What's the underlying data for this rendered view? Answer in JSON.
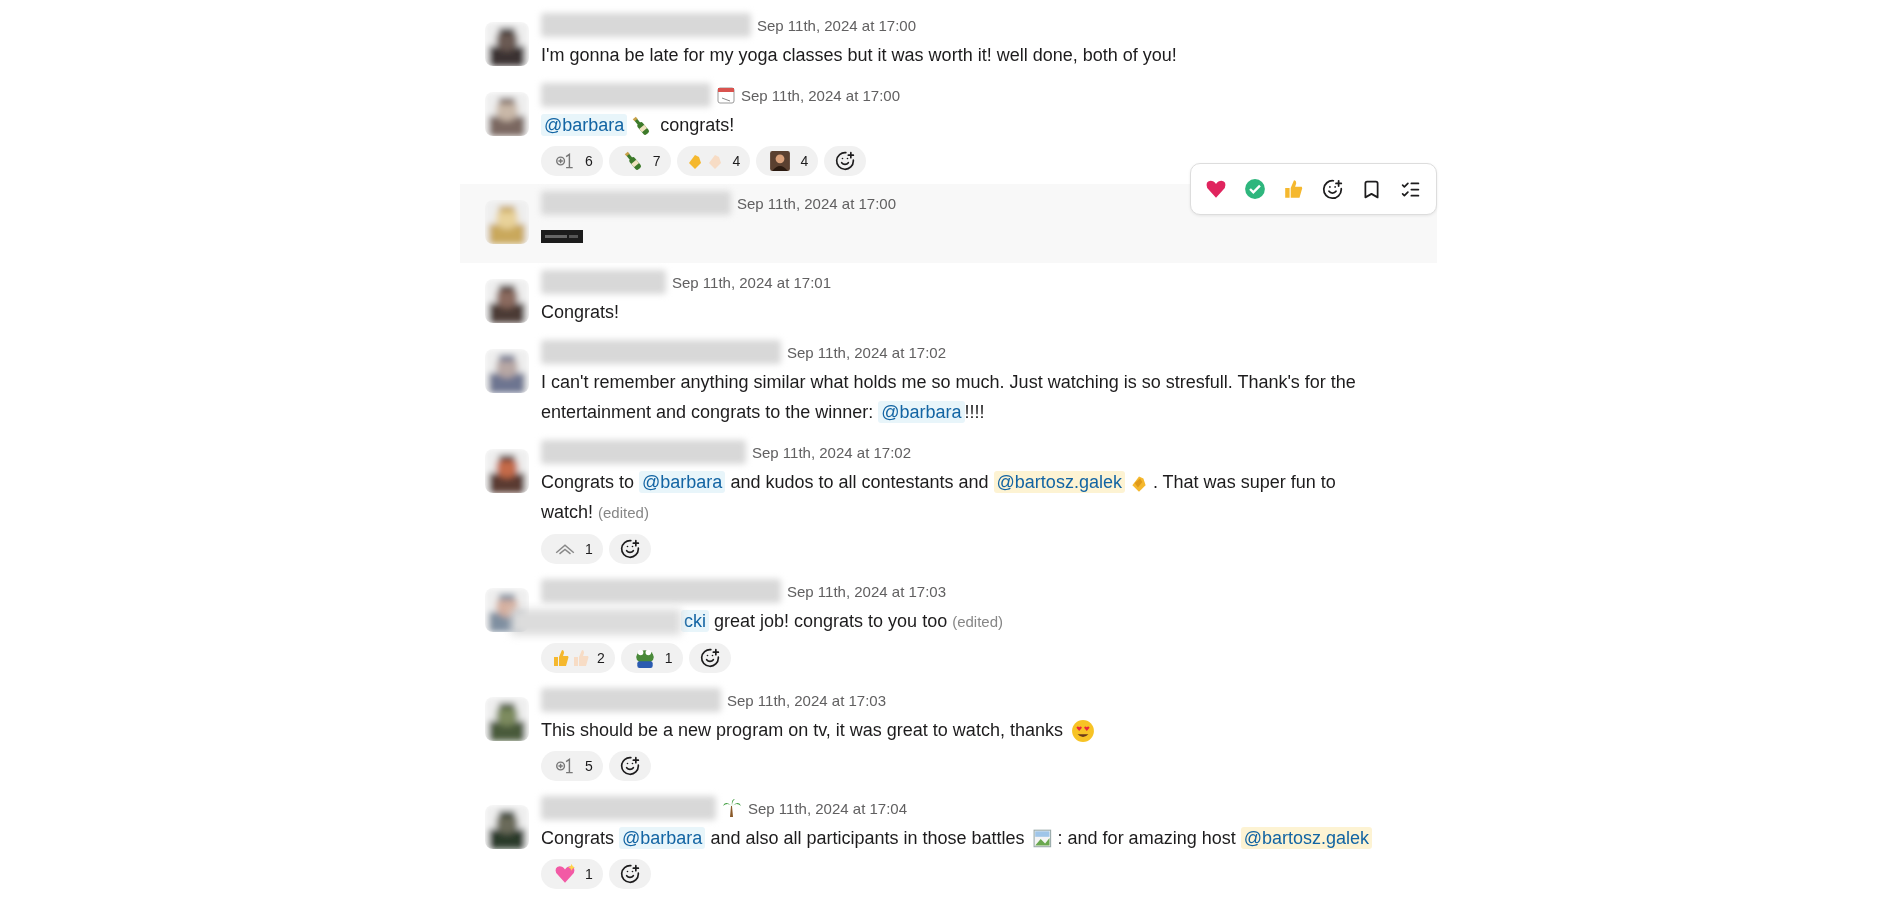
{
  "messages": [
    {
      "time": "Sep 11th, 2024 at 17:00",
      "hovered": false,
      "body": [
        {
          "kind": "text",
          "text": "I'm gonna be late for my yoga classes but it was worth it! well done, both of you!"
        }
      ]
    },
    {
      "time": "Sep 11th, 2024 at 17:00",
      "status": {
        "kind": "calendar"
      },
      "hovered": false,
      "body": [
        {
          "kind": "mention",
          "text": "@barbara",
          "self": false
        },
        {
          "kind": "bottle"
        },
        {
          "kind": "text",
          "text": " congrats!"
        }
      ],
      "reactions": [
        {
          "kind": "plusone",
          "count": "6"
        },
        {
          "kind": "bottle",
          "count": "7"
        },
        {
          "kind": "claps",
          "count": "4"
        },
        {
          "kind": "person",
          "count": "4"
        }
      ]
    },
    {
      "time": "Sep 11th, 2024 at 17:00",
      "hovered": true
    },
    {
      "time": "Sep 11th, 2024 at 17:01",
      "hovered": false,
      "body": [
        {
          "kind": "text",
          "text": "Congrats!"
        }
      ]
    },
    {
      "time": "Sep 11th, 2024 at 17:02",
      "hovered": false,
      "body": [
        {
          "kind": "text",
          "text": "I can't remember anything similar what holds me so much. Just watching is so stresfull. Thank's for the entertainment and congrats to the winner: "
        },
        {
          "kind": "mention",
          "text": "@barbara",
          "self": false
        },
        {
          "kind": "text",
          "text": "!!!!"
        }
      ]
    },
    {
      "time": "Sep 11th, 2024 at 17:02",
      "hovered": false,
      "body": [
        {
          "kind": "text",
          "text": "Congrats to "
        },
        {
          "kind": "mention",
          "text": "@barbara",
          "self": false
        },
        {
          "kind": "text",
          "text": " and kudos to all contestants and "
        },
        {
          "kind": "mention",
          "text": "@bartosz.galek",
          "self": true
        },
        {
          "kind": "clap"
        },
        {
          "kind": "text",
          "text": ". That was super fun to watch! "
        },
        {
          "kind": "edited",
          "text": "(edited)"
        }
      ],
      "reactions": [
        {
          "kind": "chevron",
          "count": "1"
        }
      ]
    },
    {
      "time": "Sep 11th, 2024 at 17:03",
      "hovered": false,
      "body": [
        {
          "kind": "blur"
        },
        {
          "kind": "mention",
          "text": "cki",
          "self": false
        },
        {
          "kind": "text",
          "text": " great job! congrats to you too "
        },
        {
          "kind": "edited",
          "text": "(edited)"
        }
      ],
      "reactions": [
        {
          "kind": "thumbs",
          "count": "2"
        },
        {
          "kind": "frog",
          "count": "1"
        }
      ]
    },
    {
      "time": "Sep 11th, 2024 at 17:03",
      "hovered": false,
      "body": [
        {
          "kind": "text",
          "text": "This should be a new program on tv, it was great to watch, thanks "
        },
        {
          "kind": "hearteyes"
        }
      ],
      "reactions": [
        {
          "kind": "plusone",
          "count": "5"
        }
      ]
    },
    {
      "time": "Sep 11th, 2024 at 17:04",
      "status": {
        "kind": "palm"
      },
      "hovered": false,
      "body": [
        {
          "kind": "text",
          "text": "Congrats "
        },
        {
          "kind": "mention",
          "text": "@barbara",
          "self": false
        },
        {
          "kind": "text",
          "text": " and also all participants in those battles "
        },
        {
          "kind": "brokenimage"
        },
        {
          "kind": "text",
          "text": ":  and for amazing host "
        },
        {
          "kind": "mention",
          "text": "@bartosz.galek",
          "self": true
        }
      ],
      "reactions": [
        {
          "kind": "sparkleheart",
          "count": "1"
        }
      ]
    }
  ]
}
